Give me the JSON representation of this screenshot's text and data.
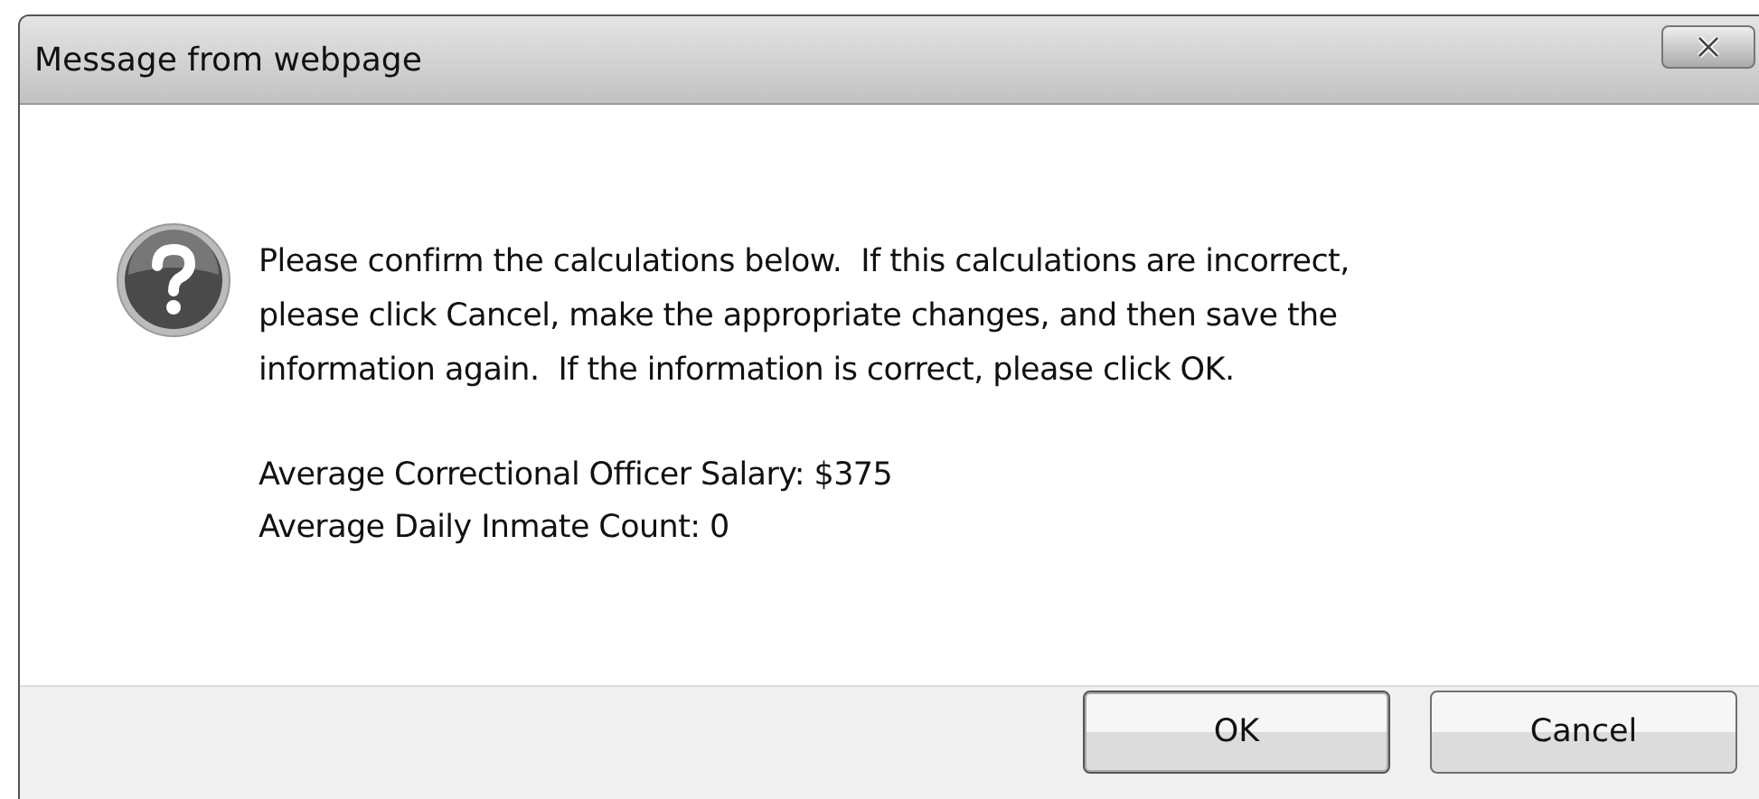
{
  "window": {
    "title": "Message from webpage"
  },
  "message": {
    "text": "Please confirm the calculations below.  If this calculations are incorrect,\nplease click Cancel, make the appropriate changes, and then save the\ninformation again.  If the information is correct, please click OK.",
    "details": [
      "Average Correctional Officer Salary: $375",
      "Average Daily Inmate Count: 0"
    ]
  },
  "buttons": [
    {
      "label": "OK",
      "default": true
    },
    {
      "label": "Cancel",
      "default": false
    }
  ]
}
